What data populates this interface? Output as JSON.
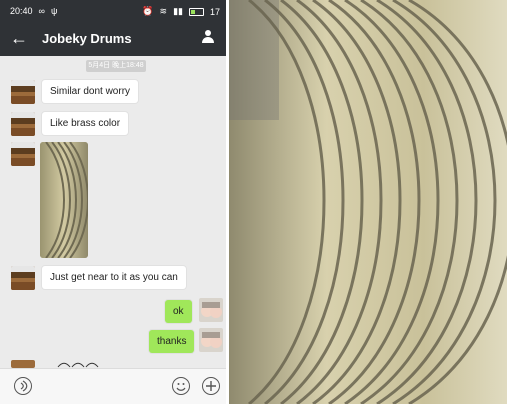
{
  "status": {
    "time": "20:40",
    "icons_left": [
      "voicemail-icon",
      "usb-icon"
    ],
    "battery": "17"
  },
  "header": {
    "title": "Jobeky Drums",
    "back_icon": "back-arrow-icon",
    "profile_icon": "person-icon"
  },
  "chat": {
    "timestamp": "5月4日 晚上18:48",
    "messages": [
      {
        "text": "Similar dont worry"
      },
      {
        "text": "Like brass color"
      },
      {
        "text": "Just get near to it as you can"
      },
      {
        "text": "ok"
      },
      {
        "text": "thanks"
      }
    ]
  },
  "inputbar": {
    "voice_icon": "voice-icon",
    "emoji_icon": "emoji-icon",
    "plus_icon": "plus-icon"
  },
  "colors": {
    "topbar": "#2f3236",
    "chat_bg": "#ebebeb",
    "sent_bubble": "#a0e75a",
    "received_bubble": "#ffffff"
  }
}
